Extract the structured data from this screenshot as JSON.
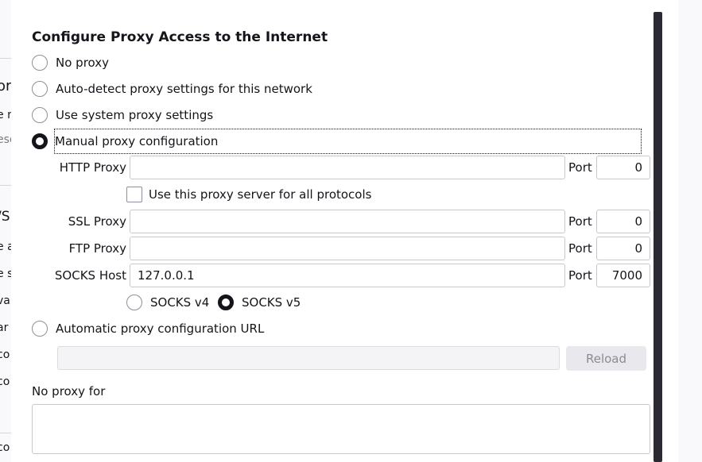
{
  "background": {
    "fragments": [
      "orn",
      "e n",
      "ese",
      "/S",
      "e a",
      "e s",
      "va",
      "ar",
      "co",
      "co",
      "co"
    ]
  },
  "dialog": {
    "title": "Configure Proxy Access to the Internet",
    "options": {
      "no_proxy": "No proxy",
      "auto_detect": "Auto-detect proxy settings for this network",
      "system": "Use system proxy settings",
      "manual": "Manual proxy configuration",
      "auto_url": "Automatic proxy configuration URL"
    },
    "selected_option": "manual",
    "http": {
      "label": "HTTP Proxy",
      "host": "",
      "port_label": "Port",
      "port": "0"
    },
    "share_label": "Use this proxy server for all protocols",
    "ssl": {
      "label": "SSL Proxy",
      "host": "",
      "port_label": "Port",
      "port": "0"
    },
    "ftp": {
      "label": "FTP Proxy",
      "host": "",
      "port_label": "Port",
      "port": "0"
    },
    "socks": {
      "label": "SOCKS Host",
      "host": "127.0.0.1",
      "port_label": "Port",
      "port": "7000"
    },
    "socks_v4": "SOCKS v4",
    "socks_v5": "SOCKS v5",
    "socks_selected": "v5",
    "auto_url_value": "",
    "reload_label": "Reload",
    "no_proxy_for_label": "No proxy for",
    "no_proxy_for_value": ""
  }
}
